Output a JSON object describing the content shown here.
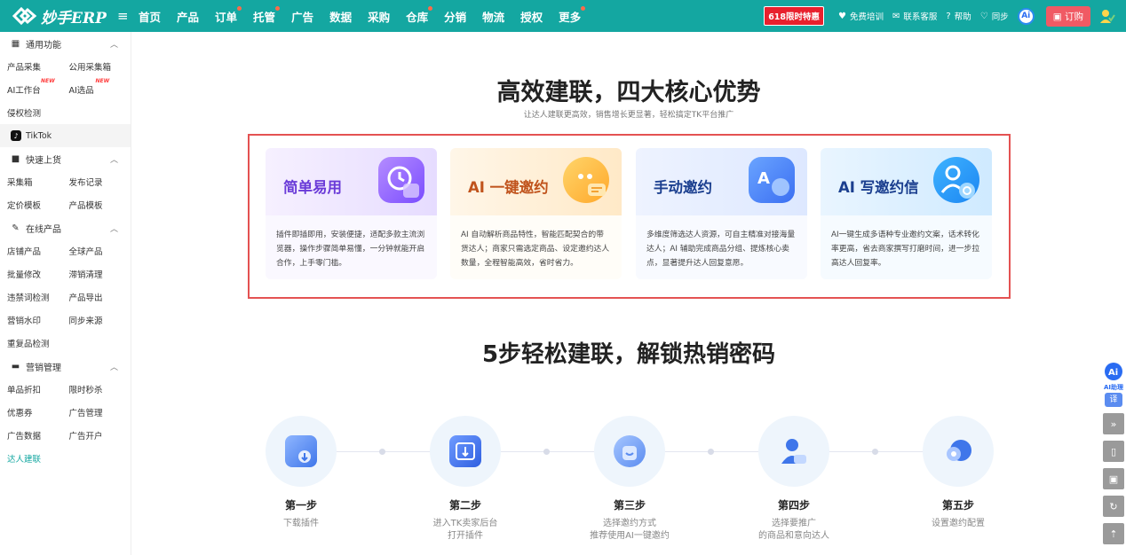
{
  "brand": {
    "name": "妙手ERP"
  },
  "nav": {
    "items": [
      {
        "label": "首页",
        "dot": false
      },
      {
        "label": "产品",
        "dot": false
      },
      {
        "label": "订单",
        "dot": true
      },
      {
        "label": "托管",
        "dot": true
      },
      {
        "label": "广告",
        "dot": false
      },
      {
        "label": "数据",
        "dot": false
      },
      {
        "label": "采购",
        "dot": false
      },
      {
        "label": "仓库",
        "dot": true
      },
      {
        "label": "分销",
        "dot": false
      },
      {
        "label": "物流",
        "dot": false
      },
      {
        "label": "授权",
        "dot": false
      },
      {
        "label": "更多",
        "dot": true
      }
    ]
  },
  "topright": {
    "promo": "618限时特惠",
    "training": "免费培训",
    "support": "联系客服",
    "help": "帮助",
    "sync": "同步",
    "ai": "Ai",
    "order": "订购"
  },
  "sidebar": {
    "g1": {
      "title": "通用功能",
      "rows": [
        [
          "产品采集",
          "公用采集箱"
        ],
        [
          "AI工作台",
          "AI选品"
        ]
      ],
      "badge": "NEW",
      "single": "侵权检测",
      "tiktok": "TikTok"
    },
    "g2": {
      "title": "快速上货",
      "rows": [
        [
          "采集箱",
          "发布记录"
        ],
        [
          "定价模板",
          "产品模板"
        ]
      ]
    },
    "g3": {
      "title": "在线产品",
      "rows": [
        [
          "店铺产品",
          "全球产品"
        ],
        [
          "批量修改",
          "滞销清理"
        ],
        [
          "违禁词检测",
          "产品导出"
        ],
        [
          "营销水印",
          "同步来源"
        ]
      ],
      "single": "重复品检测"
    },
    "g4": {
      "title": "营销管理",
      "rows": [
        [
          "单品折扣",
          "限时秒杀"
        ],
        [
          "优惠券",
          "广告管理"
        ],
        [
          "广告数据",
          "广告开户"
        ]
      ],
      "single": "达人建联"
    }
  },
  "main": {
    "title": "高效建联，四大核心优势",
    "subtitle": "让达人建联更高效，销售增长更显著，轻松搞定TK平台推广",
    "cards": [
      {
        "name": "简单易用",
        "desc": "插件即插即用，安装便捷，适配多款主流浏览器，操作步骤简单易懂，一分钟就能开启合作，上手零门槛。",
        "color": "#6a3bd8"
      },
      {
        "name": "AI 一键邀约",
        "desc": "AI 自动解析商品特性，智能匹配契合的带货达人；商家只需选定商品、设定邀约达人数量，全程智能高效，省时省力。",
        "color": "#c0531c"
      },
      {
        "name": "手动邀约",
        "desc": "多维度筛选达人资源，可自主精准对接海量达人；AI 辅助完成商品分组、提炼核心卖点，显著提升达人回复意愿。",
        "color": "#1b3f8f"
      },
      {
        "name": "AI 写邀约信",
        "desc": "AI一键生成多语种专业邀约文案，话术转化率更高，省去商家撰写打磨时间，进一步拉高达人回复率。",
        "color": "#1b3f8f"
      }
    ],
    "steps_title": "5步轻松建联，解锁热销密码",
    "steps": [
      {
        "title": "第一步",
        "desc1": "下载插件",
        "desc2": ""
      },
      {
        "title": "第二步",
        "desc1": "进入TK卖家后台",
        "desc2": "打开插件"
      },
      {
        "title": "第三步",
        "desc1": "选择邀约方式",
        "desc2": "推荐使用AI一键邀约"
      },
      {
        "title": "第四步",
        "desc1": "选择要推广",
        "desc2": "的商品和意向达人"
      },
      {
        "title": "第五步",
        "desc1": "设置邀约配置",
        "desc2": ""
      }
    ]
  },
  "tools": {
    "ai_label": "AI助理",
    "translate": "译"
  }
}
